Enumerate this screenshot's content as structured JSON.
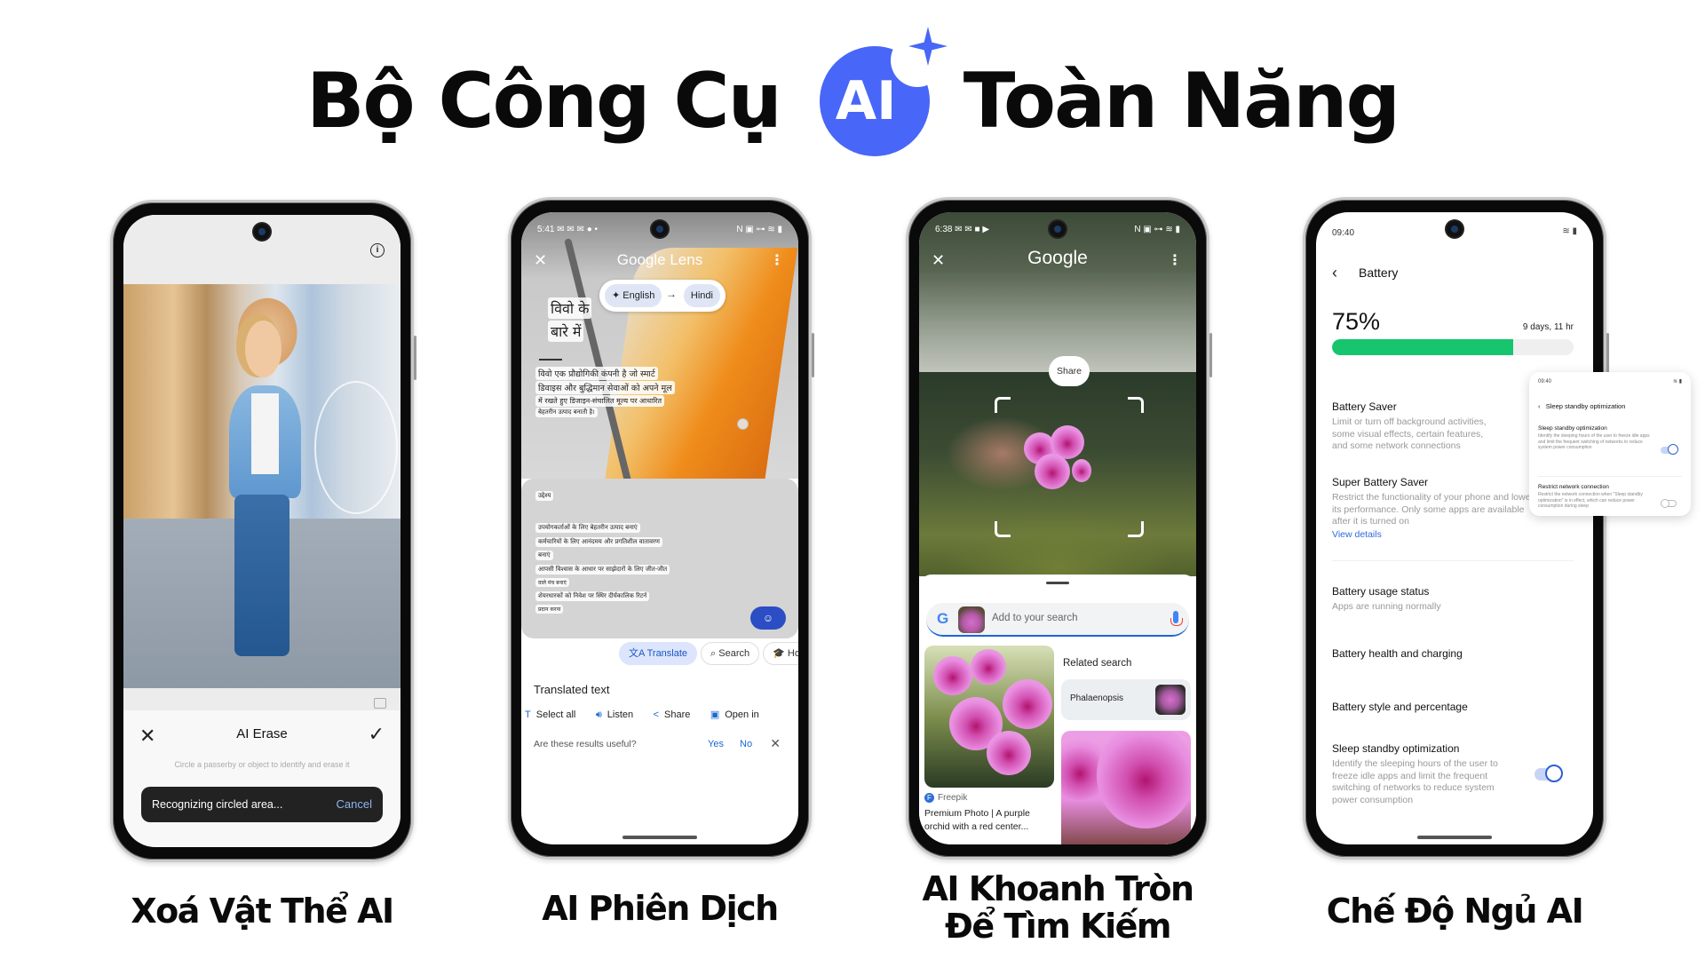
{
  "header": {
    "title_prefix": "Bộ Công Cụ",
    "badge_text": "AI",
    "title_suffix": "Toàn Năng",
    "badge_color": "#4866f7"
  },
  "phones": [
    {
      "id": "ai-erase",
      "caption": "Xoá Vật Thể AI",
      "screen": {
        "info_icon": "info-icon",
        "tool_title": "AI Erase",
        "close_icon": "close-icon",
        "confirm_icon": "check-icon",
        "hint": "Circle a passerby or object to identify and erase it",
        "toast_text": "Recognizing circled area...",
        "toast_action": "Cancel",
        "compare_icon": "compare-icon"
      }
    },
    {
      "id": "ai-translate",
      "caption": "AI Phiên Dịch",
      "screen": {
        "status_time": "5:41",
        "status_right": "N ▣ ⊶ ≋ ▮",
        "app_title": "Google Lens",
        "source_lang": "English",
        "target_lang": "Hindi",
        "heading_lines": [
          "विवो के",
          "बारे में"
        ],
        "paragraph_lines": [
          "विवो एक प्रौद्योगिकी कंपनी है जो स्मार्ट",
          "डिवाइस और बुद्धिमान सेवाओं को अपने मूल",
          "में रखते हुए डिजाइन-संचालित मूल्य पर आधारित",
          "बेहतरीन उत्पाद बनाती है।"
        ],
        "section_label": "उद्देश्य",
        "list_lines": [
          "उपयोगकर्ताओं के लिए बेहतरीन उत्पाद बनाएं",
          "कर्मचारियों के लिए आनंदमय और प्रगतिशील वातावरण",
          "बनाएं",
          "आपसी विश्वास के आधार पर साझेदारों के लिए जीत-जीत",
          "वाले मंच बनाएं",
          "शेयरधारकों को निवेश पर स्थिर दीर्घकालिक रिटर्न",
          "प्रदान करना"
        ],
        "mode_chips": [
          "Translate",
          "Search",
          "Ho"
        ],
        "translated_title": "Translated text",
        "tools": [
          "Select all",
          "Listen",
          "Share",
          "Open in"
        ],
        "feedback_question": "Are these results useful?",
        "feedback_yes": "Yes",
        "feedback_no": "No"
      }
    },
    {
      "id": "ai-circle-search",
      "caption_lines": [
        "AI Khoanh Tròn",
        "Để Tìm Kiếm"
      ],
      "screen": {
        "status_time": "6:38",
        "status_right": "N ▣ ⊶ ≋ ▮",
        "app_title": "Google",
        "share_label": "Share",
        "search_placeholder": "Add to your search",
        "related_title": "Related search",
        "related_item": "Phalaenopsis",
        "result_source": "Freepik",
        "result_title": "Premium Photo | A purple orchid with a red center..."
      }
    },
    {
      "id": "ai-sleep-mode",
      "caption": "Chế Độ Ngủ AI",
      "screen": {
        "status_time": "09:40",
        "page_title": "Battery",
        "battery_percent_label": "75%",
        "battery_level": 0.75,
        "time_remaining": "9 days, 11 hr",
        "items": [
          {
            "title": "Battery Saver",
            "desc": "Limit or turn off background activities, some visual effects, certain features, and some network connections"
          },
          {
            "title": "Super Battery Saver",
            "desc": "Restrict the functionality of your phone and lower its performance. Only some apps are available after it is turned on",
            "link": "View details"
          },
          {
            "title": "Battery usage status",
            "desc": "Apps are running normally"
          },
          {
            "title": "Battery health and charging"
          },
          {
            "title": "Battery style and percentage"
          },
          {
            "title": "Sleep standby optimization",
            "desc": "Identify the sleeping hours of the user to freeze idle apps and limit the frequent switching of networks to reduce system power consumption",
            "toggle": true
          }
        ],
        "overlay": {
          "status_time": "09:40",
          "title": "Sleep standby optimization",
          "items": [
            {
              "title": "Sleep standby optimization",
              "desc": "Identify the sleeping hours of the user to freeze idle apps and limit the frequent switching of networks to reduce system power consumption",
              "toggle": true
            },
            {
              "title": "Restrict network connection",
              "desc": "Restrict the network connection when \"Sleep standby optimization\" is in effect, which can reduce power consumption during sleep",
              "toggle": false
            }
          ]
        }
      }
    }
  ]
}
